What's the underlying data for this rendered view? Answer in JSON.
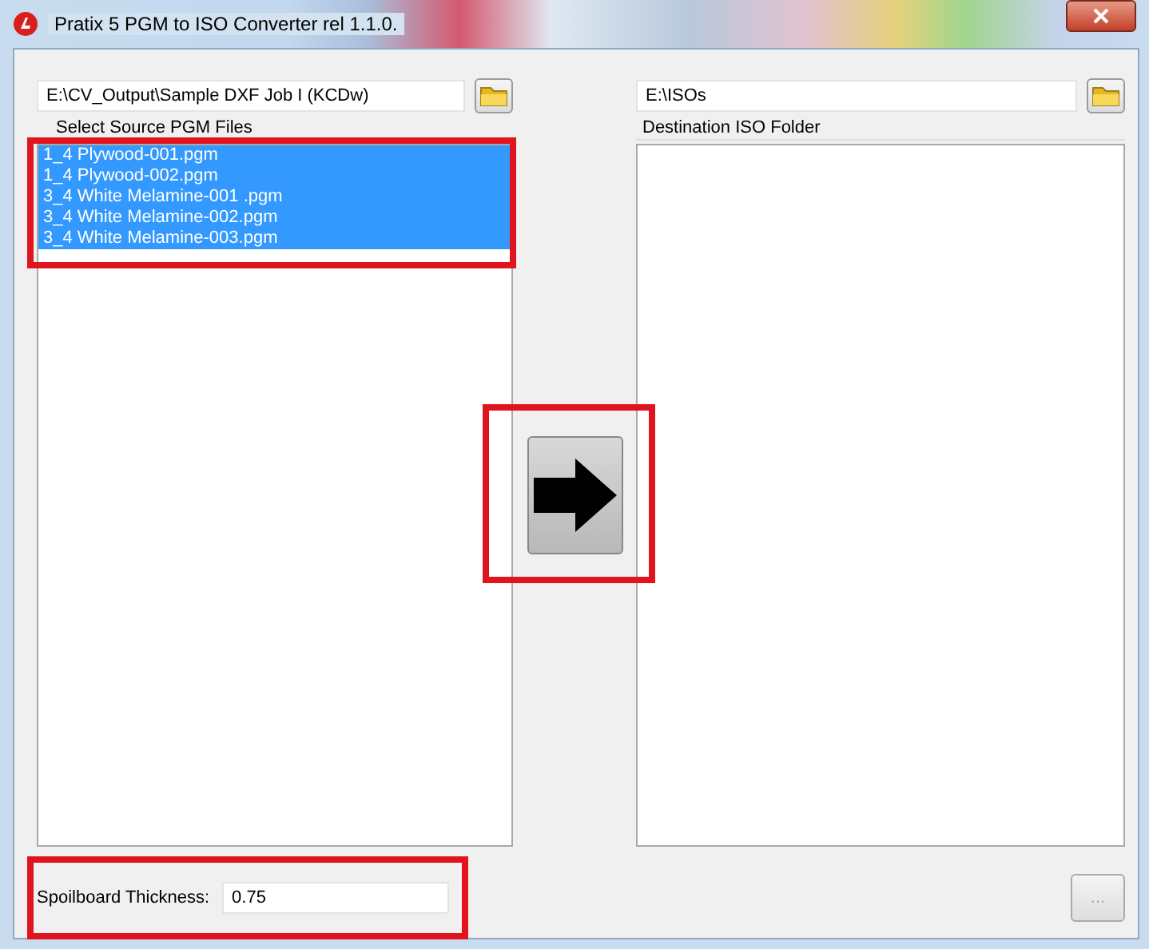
{
  "window": {
    "title": "Pratix 5 PGM to ISO Converter rel 1.1.0."
  },
  "source": {
    "path": "E:\\CV_Output\\Sample DXF Job I (KCDw)",
    "label": "Select Source PGM Files",
    "highlighted": true,
    "files": [
      {
        "name": "1_4 Plywood-001.pgm",
        "selected": true
      },
      {
        "name": "1_4 Plywood-002.pgm",
        "selected": true
      },
      {
        "name": "3_4 White Melamine-001 .pgm",
        "selected": true
      },
      {
        "name": "3_4 White Melamine-002.pgm",
        "selected": true
      },
      {
        "name": "3_4 White Melamine-003.pgm",
        "selected": true
      }
    ]
  },
  "convert": {
    "highlighted": true
  },
  "destination": {
    "path": "E:\\ISOs",
    "label": "Destination ISO Folder"
  },
  "spoilboard": {
    "label": "Spoilboard Thickness:",
    "value": "0.75",
    "highlighted": true
  },
  "more_button": {
    "label": "...",
    "disabled": true
  }
}
